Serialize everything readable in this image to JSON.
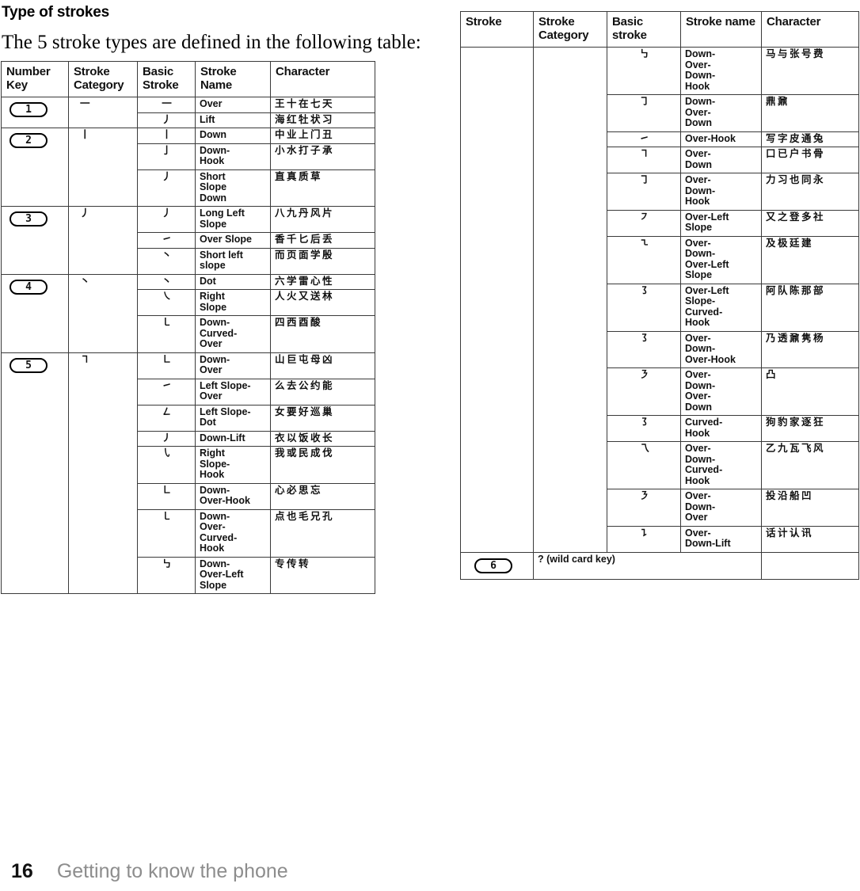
{
  "page": {
    "heading": "Type of strokes",
    "intro": "The 5 stroke types are defined in the following table:",
    "footer_page_number": "16",
    "footer_section_title": "Getting to know the phone"
  },
  "left_table": {
    "headers": {
      "number_key": "Number Key",
      "stroke_category": "Stroke Category",
      "basic_stroke": "Basic Stroke",
      "stroke_name": "Stroke Name",
      "character": "Character"
    },
    "groups": [
      {
        "number_key": "1",
        "category_glyph": "一",
        "rows": [
          {
            "basic_glyph": "一",
            "name": "Over",
            "chars": "王十在七天"
          },
          {
            "basic_glyph": "丿",
            "name": "Lift",
            "chars": "海红牡状习"
          }
        ]
      },
      {
        "number_key": "2",
        "category_glyph": "丨",
        "rows": [
          {
            "basic_glyph": "丨",
            "name": "Down",
            "chars": "中业上门丑"
          },
          {
            "basic_glyph": "亅",
            "name": "Down-\nHook",
            "chars": "小水打子承"
          },
          {
            "basic_glyph": "丿",
            "name": "Short\nSlope\nDown",
            "chars": "直真质草"
          }
        ]
      },
      {
        "number_key": "3",
        "category_glyph": "丿",
        "rows": [
          {
            "basic_glyph": "丿",
            "name": "Long Left\nSlope",
            "chars": "八九丹风片"
          },
          {
            "basic_glyph": "㇀",
            "name": "Over Slope",
            "chars": "香千匕后丢"
          },
          {
            "basic_glyph": "丶",
            "name": "Short left\nslope",
            "chars": "而页面学殷"
          }
        ]
      },
      {
        "number_key": "4",
        "category_glyph": "丶",
        "rows": [
          {
            "basic_glyph": "丶",
            "name": "Dot",
            "chars": "六学雷心性"
          },
          {
            "basic_glyph": "㇏",
            "name": "Right\nSlope",
            "chars": "人火又送林"
          },
          {
            "basic_glyph": "㇄",
            "name": "Down-\nCurved-\nOver",
            "chars": "四西酉酸"
          }
        ]
      },
      {
        "number_key": "5",
        "category_glyph": "㇕",
        "rows": [
          {
            "basic_glyph": "㇗",
            "name": "Down-\nOver",
            "chars": "山巨屯母凶"
          },
          {
            "basic_glyph": "㇀",
            "name": "Left Slope-\nOver",
            "chars": "么去公约能"
          },
          {
            "basic_glyph": "㇜",
            "name": "Left Slope-\nDot",
            "chars": "女要好巡巢"
          },
          {
            "basic_glyph": "㇓",
            "name": "Down-Lift",
            "chars": "衣以饭收长"
          },
          {
            "basic_glyph": "㇂",
            "name": "Right\nSlope-\nHook",
            "chars": "我或民成伐"
          },
          {
            "basic_glyph": "㇗",
            "name": "Down-\nOver-Hook",
            "chars": "心必思忘"
          },
          {
            "basic_glyph": "㇄",
            "name": "Down-\nOver-\nCurved-\nHook",
            "chars": "点也毛兄孔"
          },
          {
            "basic_glyph": "㇉",
            "name": "Down-\nOver-Left\nSlope",
            "chars": "专传转"
          }
        ]
      }
    ]
  },
  "right_table": {
    "headers": {
      "stroke": "Stroke",
      "stroke_category": "Stroke Category",
      "basic_stroke": "Basic stroke",
      "stroke_name": "Stroke name",
      "character": "Character"
    },
    "rows": [
      {
        "basic_glyph": "㇉",
        "name": "Down-\nOver-\nDown-\nHook",
        "chars": "马与张号费"
      },
      {
        "basic_glyph": "㇆",
        "name": "Down-\nOver-\nDown",
        "chars": "鼎鼐"
      },
      {
        "basic_glyph": "㇀",
        "name": "Over-Hook",
        "chars": "写字皮通兔"
      },
      {
        "basic_glyph": "㇕",
        "name": "Over-\nDown",
        "chars": "口已户书骨"
      },
      {
        "basic_glyph": "㇆",
        "name": "Over-\nDown-\nHook",
        "chars": "力习也同永"
      },
      {
        "basic_glyph": "㇇",
        "name": "Over-Left\nSlope",
        "chars": "又之登多社"
      },
      {
        "basic_glyph": "㇍",
        "name": "Over-\nDown-\nOver-Left\nSlope",
        "chars": "及极廷建"
      },
      {
        "basic_glyph": "㇌",
        "name": "Over-Left\nSlope-\nCurved-\nHook",
        "chars": "阿队陈那部"
      },
      {
        "basic_glyph": "㇌",
        "name": "Over-\nDown-\nOver-Hook",
        "chars": "乃透鼐隽杨"
      },
      {
        "basic_glyph": "㇋",
        "name": "Over-\nDown-\nOver-\nDown",
        "chars": "凸"
      },
      {
        "basic_glyph": "㇌",
        "name": "Curved-\nHook",
        "chars": "狗豹家逐狂"
      },
      {
        "basic_glyph": "乁",
        "name": "Over-\nDown-\nCurved-\nHook",
        "chars": "乙九瓦飞风"
      },
      {
        "basic_glyph": "㇋",
        "name": "Over-\nDown-\nOver",
        "chars": "投沿船凹"
      },
      {
        "basic_glyph": "㇊",
        "name": "Over-\nDown-Lift",
        "chars": "话计认讯"
      }
    ],
    "wildcard_row": {
      "number_key": "6",
      "label": "? (wild card key)"
    }
  }
}
